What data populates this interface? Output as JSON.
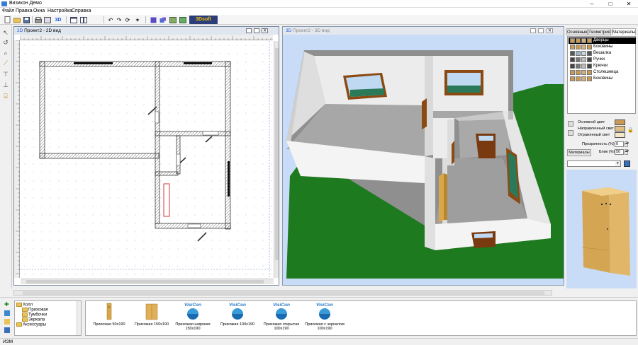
{
  "window": {
    "title": "Визикон Демо"
  },
  "menu": [
    "Файл",
    "Правка",
    "Окна",
    "Настройка",
    "Справка"
  ],
  "toolbar": {
    "badge_label": "3Dsoft"
  },
  "view2d": {
    "icon": "2D",
    "title": "Проект2 - 2D вид"
  },
  "view3d": {
    "icon": "3D",
    "title": "Проект2 - 3D вид"
  },
  "right_panel": {
    "tabs": [
      "Основные",
      "Геометрия",
      "Материалы"
    ],
    "active_tab": "Материалы",
    "materials": [
      {
        "label": "Дверцы",
        "selected": true,
        "colors": [
          "#c89a55",
          "#c89a55",
          "#d4b07a",
          "#c89a55"
        ]
      },
      {
        "label": "Боковины",
        "selected": false,
        "colors": [
          "#c89a55",
          "#c89a55",
          "#d4b07a",
          "#c89a55"
        ]
      },
      {
        "label": "Вешалка",
        "selected": false,
        "colors": [
          "#555555",
          "#9fb0c0",
          "#c8d4de",
          "#555555"
        ]
      },
      {
        "label": "Ручки",
        "selected": false,
        "colors": [
          "#444444",
          "#777777",
          "#bbbbbb",
          "#444444"
        ]
      },
      {
        "label": "Крючки",
        "selected": false,
        "colors": [
          "#444444",
          "#777777",
          "#bbbbbb",
          "#444444"
        ]
      },
      {
        "label": "Столешница",
        "selected": false,
        "colors": [
          "#c89a55",
          "#c89a55",
          "#d4b07a",
          "#c89a55"
        ]
      },
      {
        "label": "Боковины",
        "selected": false,
        "colors": [
          "#c89a55",
          "#c89a55",
          "#d4b07a",
          "#c89a55"
        ]
      }
    ],
    "light": {
      "base_label": "Основной цвет",
      "directed_label": "Направленный свет",
      "reflected_label": "Отраженный свет",
      "base_color": "#c89a55",
      "directed_color": "#e0bf85",
      "reflected_color": "#f5e8c8"
    },
    "transparency_label": "Прозрачность (%)",
    "transparency_value": "0",
    "shine_label": "Блик (%)",
    "shine_value": "50",
    "materials_button": "Материалы"
  },
  "tree": {
    "items": [
      {
        "label": "Холл",
        "level": 0
      },
      {
        "label": "Прихожая",
        "level": 1
      },
      {
        "label": "Тумбочки",
        "level": 1
      },
      {
        "label": "Зеркала",
        "level": 1
      },
      {
        "label": "Аксессуары",
        "level": 0
      }
    ]
  },
  "catalog": [
    {
      "label": "Прихожая 50x190",
      "thumb": "narrow"
    },
    {
      "label": "Прихожая 150x190",
      "thumb": "wide"
    },
    {
      "label": "Прихожая широкая 150x190",
      "thumb": "logo"
    },
    {
      "label": "Прихожая 100x190",
      "thumb": "logo"
    },
    {
      "label": "Прихожая открытая 100x190",
      "thumb": "logo"
    },
    {
      "label": "Прихожая с зеркалом 100x190",
      "thumb": "logo"
    }
  ],
  "logo_text": "VisiCon",
  "status": {
    "mode": "ИЗМ"
  },
  "colors": {
    "accent": "#1e5ad7",
    "grass": "#1e7a1e",
    "wall": "#e8e8e8",
    "floor": "#9a9a9a",
    "sky": "#c9dcf7"
  }
}
